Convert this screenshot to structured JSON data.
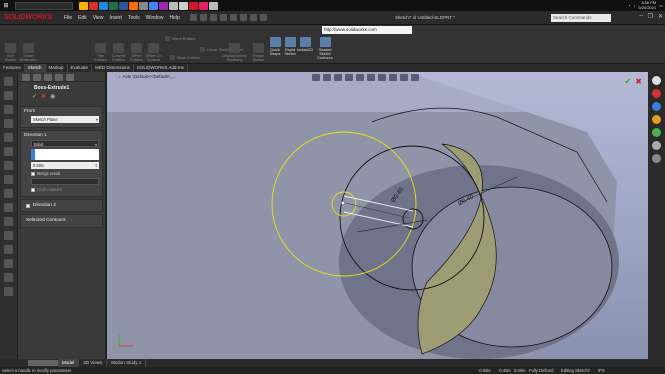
{
  "taskbar": {
    "search_placeholder": "",
    "apps": [
      "#f5b400",
      "#d93025",
      "#1e88e5",
      "#217346",
      "#2b579a",
      "#ff6d00",
      "#888888",
      "#4285f4",
      "#9c27b0",
      "#bbbbbb",
      "#cccccc",
      "#d0181f",
      "#e91e63",
      "#bbbbbb"
    ],
    "time": "3:56 PM",
    "date": "5/20/2021"
  },
  "app": {
    "logo": "SOLIDWORKS",
    "menu": [
      "File",
      "Edit",
      "View",
      "Insert",
      "Tools",
      "Window",
      "Help"
    ],
    "doc_title": "Sketch7 of Untitled-SLDPRT *",
    "search_placeholder": "Search Commands"
  },
  "commands": {
    "url": "http://www.solidworks.com",
    "items": [
      {
        "label": "Exit Sketch",
        "active": false
      },
      {
        "label": "Smart Dimension",
        "active": false
      },
      {
        "label": "Trim Entities",
        "active": false
      },
      {
        "label": "Convert Entities",
        "active": false
      },
      {
        "label": "Offset Entities",
        "active": false
      },
      {
        "label": "Offset On Surface",
        "active": false
      },
      {
        "label": "Mirror Entities",
        "active": false
      },
      {
        "label": "Linear Sketch Pattern",
        "active": false
      },
      {
        "label": "Move Entities",
        "active": false
      },
      {
        "label": "Display/Delete Relations",
        "active": false
      },
      {
        "label": "Repair Sketch",
        "active": false
      },
      {
        "label": "Quick Snaps",
        "active": true
      },
      {
        "label": "Rapid Sketch",
        "active": true
      },
      {
        "label": "Instant2D",
        "active": true
      },
      {
        "label": "Shaded Sketch Contours",
        "active": true
      }
    ]
  },
  "tabs": [
    "Features",
    "Sketch",
    "Markup",
    "Evaluate",
    "MBD Dimensions",
    "SOLIDWORKS Add-Ins"
  ],
  "active_tab": "Sketch",
  "property_manager": {
    "title": "Boss-Extrude1",
    "from_label": "From",
    "from_value": "Sketch Plane",
    "direction1_label": "Direction 1",
    "end_condition": "Blind",
    "depth": "0.50in",
    "merge_result": "Merge result",
    "draft_outward": "Draft outward",
    "direction2_label": "Direction 2",
    "selected_contours_label": "Selected Contours"
  },
  "viewport": {
    "tree_flyout": "Axle  (Default<<Default>_...",
    "dim1": "Ø0.40",
    "dim2": "Ø0.40"
  },
  "task_pane_colors": [
    "#dddddd",
    "#d33333",
    "#3a7fe0",
    "#e0a020",
    "#4caf50",
    "#aaaaaa",
    "#888888"
  ],
  "bottom_tabs": [
    "Model",
    "3D Views",
    "Motion Study 1"
  ],
  "active_bottom_tab": "Model",
  "status": {
    "message": "Select a handle to modify parameters",
    "x": "-0.06in",
    "y": "-0.45in",
    "z": "0.00in",
    "defined": "Fully Defined",
    "editing": "Editing Sketch7",
    "units": "IPS"
  }
}
